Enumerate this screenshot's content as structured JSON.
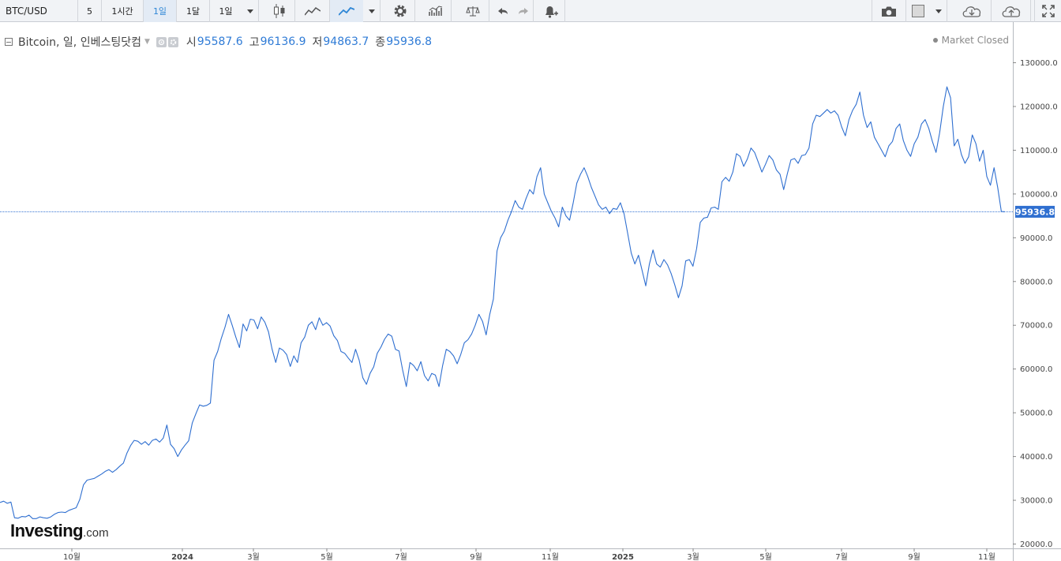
{
  "toolbar": {
    "symbol": "BTC/USD",
    "intervals": [
      "5",
      "1시간",
      "1일",
      "1달",
      "1일"
    ],
    "active_interval_index": 2
  },
  "legend": {
    "title": "Bitcoin, 일, 인베스팅닷컴",
    "open_label": "시",
    "open_value": "95587.6",
    "high_label": "고",
    "high_value": "96136.9",
    "low_label": "저",
    "low_value": "94863.7",
    "close_label": "종",
    "close_value": "95936.8"
  },
  "status": "Market Closed",
  "watermark": {
    "brand": "Investing",
    "domain": ".com"
  },
  "colors": {
    "line": "#2f6fd0",
    "price_tag": "#2f6fd0",
    "active": "#2f87d6"
  },
  "chart_data": {
    "type": "line",
    "series": [
      {
        "values": [
          29500,
          29800,
          29300,
          29600,
          26000,
          25900,
          26300,
          26200,
          26600,
          25800,
          25800,
          26200,
          26000,
          25900,
          26200,
          26800,
          27200,
          27300,
          27200,
          27700,
          28000,
          28300,
          30200,
          33500,
          34600,
          34800,
          35000,
          35500,
          36000,
          36600,
          37000,
          36400,
          37000,
          37800,
          38500,
          40800,
          42500,
          43700,
          43500,
          42800,
          43400,
          42600,
          43700,
          44000,
          43300,
          44200,
          47200,
          42800,
          41800,
          40000,
          41500,
          42600,
          43600,
          47700,
          49800,
          51800,
          51500,
          51700,
          52200,
          62000,
          64000,
          67000,
          69500,
          72500,
          70000,
          67300,
          64900,
          70300,
          68700,
          71400,
          71200,
          69200,
          71900,
          70700,
          68500,
          64500,
          61500,
          64800,
          64300,
          63300,
          60600,
          63000,
          61500,
          66000,
          67300,
          70000,
          70800,
          69000,
          71700,
          70000,
          70600,
          69800,
          67600,
          66500,
          64000,
          63600,
          62500,
          61500,
          64500,
          62000,
          58000,
          56500,
          59000,
          60500,
          63600,
          65000,
          66800,
          68000,
          67500,
          64500,
          64100,
          59700,
          56000,
          61500,
          60800,
          59600,
          61700,
          58500,
          57300,
          59000,
          58600,
          56000,
          60800,
          64500,
          64000,
          63000,
          61200,
          63300,
          66000,
          66700,
          68000,
          70000,
          72500,
          70900,
          67800,
          72500,
          76000,
          87000,
          90000,
          91500,
          94000,
          96000,
          98500,
          97000,
          96500,
          99000,
          101000,
          100000,
          104000,
          106000,
          100000,
          98000,
          96000,
          94500,
          92500,
          97000,
          95000,
          94000,
          98000,
          102500,
          104500,
          106000,
          104000,
          101500,
          99500,
          97500,
          96500,
          97000,
          95500,
          96700,
          96500,
          98000,
          95500,
          91000,
          86500,
          84000,
          86000,
          82500,
          79000,
          84000,
          87200,
          84000,
          83300,
          85000,
          83800,
          81800,
          79200,
          76300,
          79000,
          84700,
          85000,
          83500,
          87500,
          93500,
          94500,
          94700,
          96800,
          97000,
          96500,
          102800,
          103800,
          102900,
          105000,
          109200,
          108600,
          106300,
          108000,
          110500,
          109500,
          107300,
          105000,
          106800,
          108800,
          107800,
          105500,
          104500,
          101000,
          104600,
          107800,
          108100,
          107000,
          108800,
          109000,
          110500,
          116000,
          118000,
          117700,
          118500,
          119300,
          118500,
          119000,
          118000,
          115300,
          113300,
          117000,
          119100,
          120500,
          123300,
          118000,
          115200,
          116500,
          113000,
          111500,
          110000,
          108500,
          111000,
          112000,
          115000,
          116000,
          112200,
          110000,
          108600,
          111500,
          113000,
          116000,
          117000,
          115000,
          112000,
          109500,
          114000,
          120000,
          124500,
          122000,
          111000,
          112500,
          109000,
          107000,
          108500,
          113500,
          111500,
          107500,
          110000,
          104000,
          102000,
          106000,
          101500,
          96000,
          95936.8
        ]
      }
    ],
    "x_tick_labels": [
      "10월",
      "2024",
      "3월",
      "5월",
      "7월",
      "9월",
      "11월",
      "2025",
      "3월",
      "5월",
      "7월",
      "9월",
      "11월"
    ],
    "y_tick_labels": [
      "20000.0",
      "30000.0",
      "40000.0",
      "50000.0",
      "60000.0",
      "70000.0",
      "80000.0",
      "90000.0",
      "100000.0",
      "110000.0",
      "120000.0",
      "130000.0"
    ],
    "ylim": [
      20000,
      130000
    ],
    "last_price": 95936.8,
    "last_price_label": "95936.8"
  }
}
